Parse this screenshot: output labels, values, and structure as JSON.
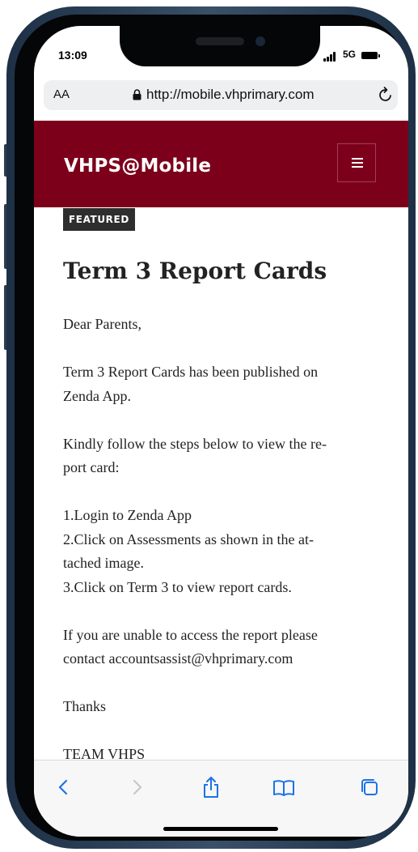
{
  "status_bar": {
    "time": "13:09",
    "network": "5G"
  },
  "address_bar": {
    "aa_label": "AA",
    "url": "http://mobile.vhprimary.com"
  },
  "site": {
    "title": "VHPS@Mobile"
  },
  "article": {
    "badge": "FEATURED",
    "title": "Term 3 Report Cards",
    "greeting": "Dear Parents,",
    "line1a": "Term 3 Report Cards has been published on",
    "line1b": "Zenda App.",
    "line2a": "Kindly follow the steps below to view the re-",
    "line2b": "port card:",
    "step1": "1.Login to Zenda App",
    "step2a": "2.Click on Assessments as shown in the at-",
    "step2b": "tached image.",
    "step3": "3.Click on Term 3 to view report cards.",
    "line3a": "If you are unable to access the report please",
    "line3b": "contact accountsassist@vhprimary.com",
    "thanks": "Thanks",
    "signoff": "TEAM VHPS"
  },
  "toolbar": {
    "icons": [
      "back-icon",
      "forward-icon",
      "share-icon",
      "bookmarks-icon",
      "tabs-icon"
    ],
    "accent_color": "#1a73e8",
    "disabled_color": "#c7c7cc"
  },
  "colors": {
    "header": "#7d001b",
    "badge": "#2e2e2e",
    "text": "#222222"
  }
}
